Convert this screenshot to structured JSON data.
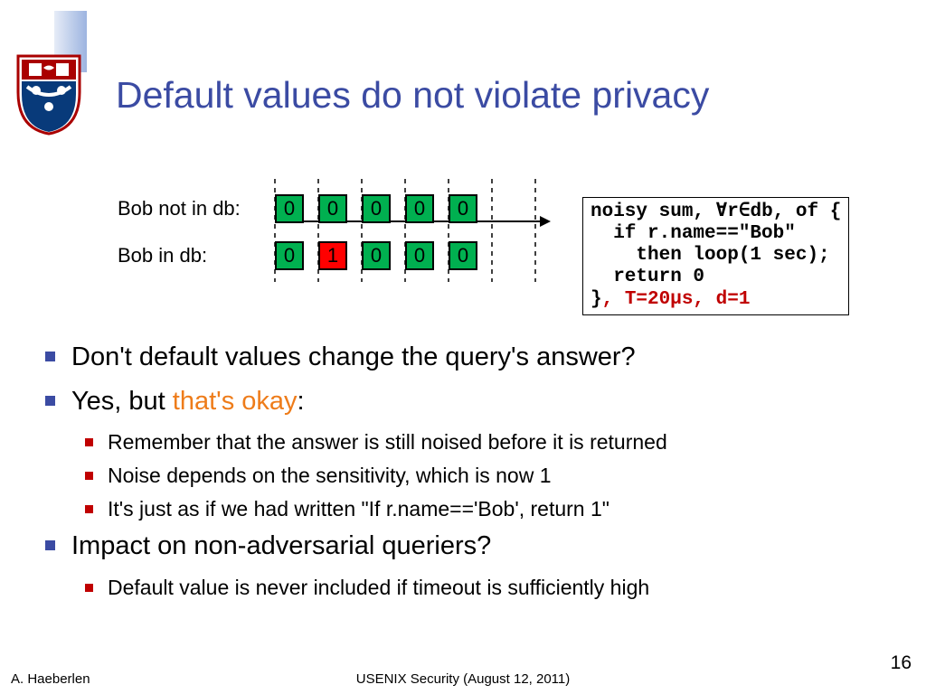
{
  "title": "Default values do not violate privacy",
  "rows": {
    "not_in_db": {
      "label": "Bob not in db:",
      "cells": [
        {
          "v": "0",
          "c": "green"
        },
        {
          "v": "0",
          "c": "green"
        },
        {
          "v": "0",
          "c": "green"
        },
        {
          "v": "0",
          "c": "green"
        },
        {
          "v": "0",
          "c": "green"
        }
      ]
    },
    "in_db": {
      "label": "Bob in db:",
      "cells": [
        {
          "v": "0",
          "c": "green"
        },
        {
          "v": "1",
          "c": "red"
        },
        {
          "v": "0",
          "c": "green"
        },
        {
          "v": "0",
          "c": "green"
        },
        {
          "v": "0",
          "c": "green"
        }
      ]
    }
  },
  "code": {
    "l1a": "noisy sum, ",
    "l1b": "∀r∈db",
    "l1c": ", of {",
    "l2": "  if r.name==\"Bob\"",
    "l3": "    then loop(1 sec);",
    "l4": "  return 0",
    "l5a": "}",
    "l5b": ", T=20µs, d=1"
  },
  "bullets": [
    {
      "level": 1,
      "text": "Don't default values change the query's answer?"
    },
    {
      "level": 1,
      "text_a": "Yes, but ",
      "text_orange": "that's okay",
      "text_b": ":"
    },
    {
      "level": 2,
      "text": "Remember that the answer is still noised before it is returned"
    },
    {
      "level": 2,
      "text": "Noise depends on the sensitivity, which is now 1"
    },
    {
      "level": 2,
      "text": "It's just as if we had written \"If r.name=='Bob', return 1\""
    },
    {
      "level": 1,
      "text": "Impact on non-adversarial queriers?"
    },
    {
      "level": 2,
      "text": "Default value is never included if timeout is sufficiently high"
    }
  ],
  "footer": {
    "left": "A. Haeberlen",
    "center": "USENIX Security (August 12, 2011)",
    "page": "16"
  }
}
